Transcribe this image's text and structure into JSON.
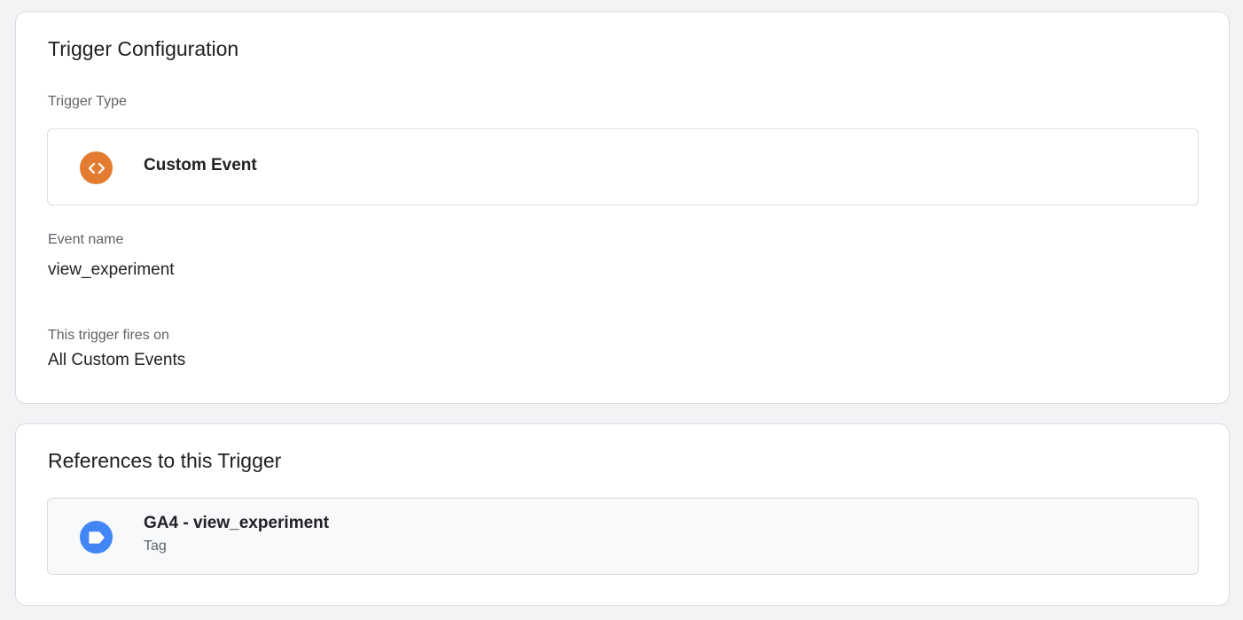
{
  "trigger_config": {
    "title": "Trigger Configuration",
    "type_label": "Trigger Type",
    "type": {
      "name": "Custom Event",
      "icon": "code-brackets-icon",
      "icon_color": "#e37b31"
    },
    "event_name_label": "Event name",
    "event_name_value": "view_experiment",
    "fires_on_label": "This trigger fires on",
    "fires_on_value": "All Custom Events"
  },
  "references": {
    "title": "References to this Trigger",
    "items": [
      {
        "name": "GA4 - view_experiment",
        "type": "Tag",
        "icon": "tag-icon",
        "icon_color": "#4285f4"
      }
    ]
  }
}
